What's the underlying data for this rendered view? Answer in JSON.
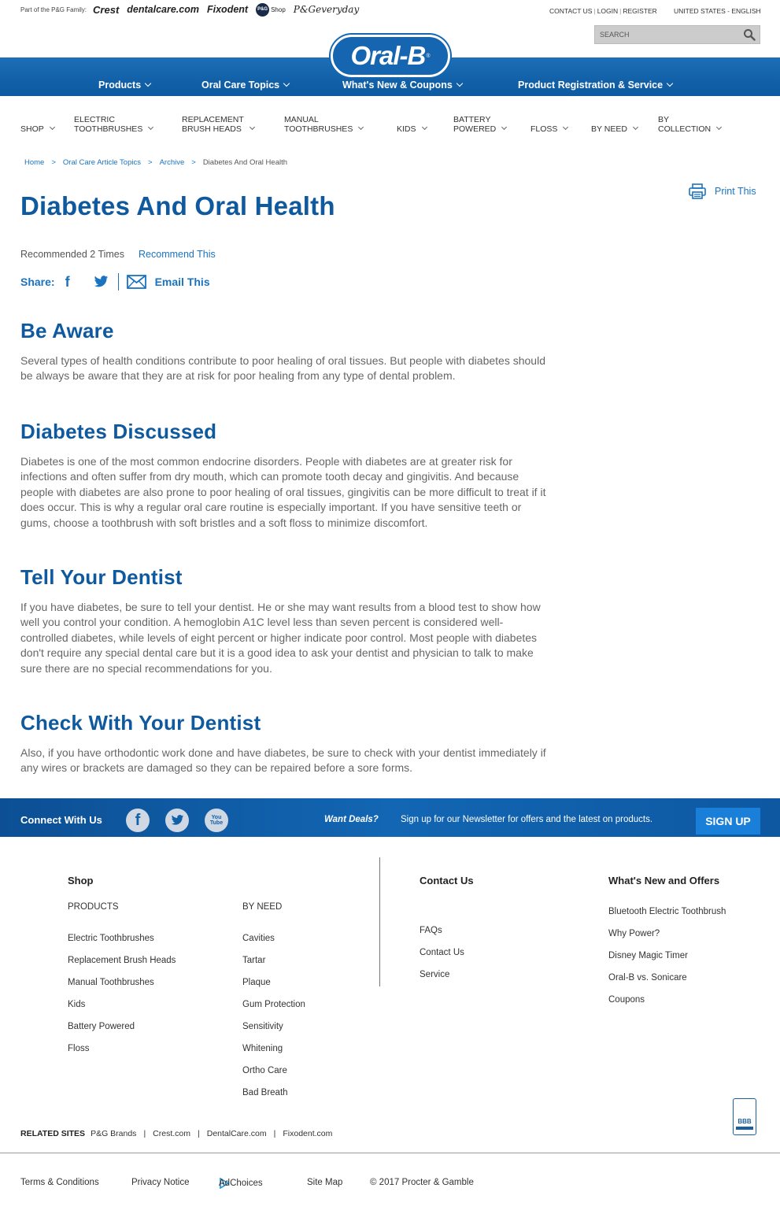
{
  "topbar": {
    "family_label": "Part of the P&G Family:",
    "brands": [
      "Crest",
      "dentalcare.com",
      "Fixodent",
      "P&G",
      "Shop",
      "P&Geveryday"
    ],
    "links": [
      "CONTACT US",
      "LOGIN",
      "REGISTER"
    ],
    "locale": "UNITED STATES - ENGLISH",
    "search_placeholder": "SEARCH"
  },
  "logo": {
    "text": "Oral-B",
    "mark": "®"
  },
  "main_nav": [
    "Products",
    "Oral Care Topics",
    "What's New & Coupons",
    "Product Registration & Service"
  ],
  "sub_nav": [
    {
      "l1": "SHOP",
      "l2": ""
    },
    {
      "l1": "ELECTRIC",
      "l2": "TOOTHBRUSHES"
    },
    {
      "l1": "REPLACEMENT",
      "l2": "BRUSH HEADS"
    },
    {
      "l1": "MANUAL",
      "l2": "TOOTHBRUSHES"
    },
    {
      "l1": "KIDS",
      "l2": ""
    },
    {
      "l1": "BATTERY",
      "l2": "POWERED"
    },
    {
      "l1": "FLOSS",
      "l2": ""
    },
    {
      "l1": "BY NEED",
      "l2": ""
    },
    {
      "l1": "BY",
      "l2": "COLLECTION"
    }
  ],
  "breadcrumb": {
    "links": [
      "Home",
      "Oral Care Article Topics",
      "Archive"
    ],
    "separator": ">",
    "current": "Diabetes And Oral Health"
  },
  "print_label": "Print This",
  "article": {
    "title": "Diabetes And Oral Health",
    "recommended": "Recommended 2 Times",
    "recommend_link": "Recommend This",
    "share_label": "Share:",
    "email_label": "Email This",
    "sections": [
      {
        "heading": "Be Aware",
        "body": "Several types of health conditions contribute to poor healing of oral tissues. But people with diabetes should be always be aware that they are at risk for poor healing from any type of dental problem."
      },
      {
        "heading": "Diabetes Discussed",
        "body": "Diabetes is one of the most common endocrine disorders. People with diabetes are at greater risk for infections and often suffer from dry mouth, which can promote tooth decay and gingivitis. And because people with diabetes are also prone to poor healing of oral tissues, gingivitis can be more difficult to treat if it does occur. This is why a regular oral care routine is especially important. If you have sensitive teeth or gums, choose a toothbrush with soft bristles and a soft floss to minimize discomfort."
      },
      {
        "heading": "Tell Your Dentist",
        "body": "If you have diabetes, be sure to tell your dentist. He or she may want results from a blood test to show how well you control your condition. A hemoglobin A1C level less than seven percent is considered well-controlled diabetes, while levels of eight percent or higher indicate poor control. Most people with diabetes don't require any special dental care but it is a good idea to ask your dentist and physician to talk to make sure there are no special recommendations for you."
      },
      {
        "heading": "Check With Your Dentist",
        "body": "Also, if you have orthodontic work done and have diabetes, be sure to check with your dentist immediately if any wires or brackets are damaged so they can be repaired before a sore forms."
      }
    ]
  },
  "connect": {
    "label": "Connect With Us",
    "youtube_label": "You Tube",
    "deals_label": "Want Deals?",
    "newsletter_text": "Sign up for our Newsletter for offers and the latest on products.",
    "signup_label": "SIGN UP"
  },
  "footer": {
    "shop_title": "Shop",
    "products_label": "PRODUCTS",
    "products": [
      "Electric Toothbrushes",
      "Replacement Brush Heads",
      "Manual Toothbrushes",
      "Kids",
      "Battery Powered",
      "Floss"
    ],
    "by_need_label": "BY NEED",
    "by_need": [
      "Cavities",
      "Tartar",
      "Plaque",
      "Gum Protection",
      "Sensitivity",
      "Whitening",
      "Ortho Care",
      "Bad Breath"
    ],
    "contact_title": "Contact Us",
    "contact": [
      "FAQs",
      "Contact Us",
      "Service"
    ],
    "whats_new_title": "What's New and Offers",
    "whats_new": [
      "Bluetooth Electric Toothbrush",
      "Why Power?",
      "Disney Magic Timer",
      "Oral-B vs. Sonicare",
      "Coupons"
    ],
    "related_title": "RELATED SITES",
    "related": [
      "P&G Brands",
      "Crest.com",
      "DentalCare.com",
      "Fixodent.com"
    ],
    "related_separator": "|",
    "bbb_label": "BBB",
    "legal": [
      "Terms & Conditions",
      "Privacy Notice",
      "AdChoices",
      "Site Map",
      "© 2017 Procter & Gamble"
    ]
  },
  "colors": {
    "brand_blue": "#1160a8",
    "heading_blue": "#0f5a9e",
    "link_blue": "#1a73c0"
  }
}
